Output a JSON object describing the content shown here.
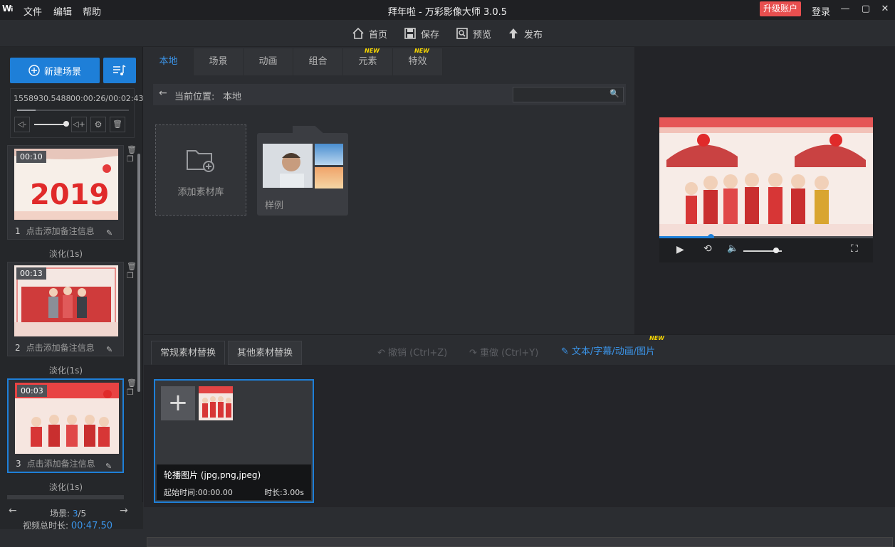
{
  "titlebar": {
    "logo": "W",
    "menu": [
      "文件",
      "编辑",
      "帮助"
    ],
    "title": "拜年啦 - 万彩影像大师 3.0.5",
    "upgrade": "升级账户",
    "login": "登录"
  },
  "toolbar": {
    "home": "首页",
    "save": "保存",
    "preview": "预览",
    "publish": "发布"
  },
  "left": {
    "new_scene": "新建场景",
    "time_left": "1558930.5488",
    "time_right": "00:00:26/00:02:43",
    "scenes": [
      {
        "index": "1",
        "duration": "00:10",
        "note": "点击添加备注信息",
        "transition": "淡化(1s)"
      },
      {
        "index": "2",
        "duration": "00:13",
        "note": "点击添加备注信息",
        "transition": "淡化(1s)"
      },
      {
        "index": "3",
        "duration": "00:03",
        "note": "点击添加备注信息",
        "transition": "淡化(1s)"
      }
    ],
    "footer": {
      "scene_label": "场景:",
      "scene_current": "3",
      "scene_total": "/5",
      "total_label": "视频总时长:",
      "total_value": "00:47.50"
    }
  },
  "center": {
    "tabs": [
      {
        "label": "本地",
        "new": ""
      },
      {
        "label": "场景",
        "new": ""
      },
      {
        "label": "动画",
        "new": ""
      },
      {
        "label": "组合",
        "new": ""
      },
      {
        "label": "元素",
        "new": "NEW"
      },
      {
        "label": "特效",
        "new": "NEW"
      }
    ],
    "path_label": "当前位置:",
    "path_value": "本地",
    "add_library": "添加素材库",
    "folder_name": "样例"
  },
  "bottom": {
    "tab_regular": "常规素材替换",
    "tab_other": "其他素材替换",
    "undo": "撤销 (Ctrl+Z)",
    "redo": "重做 (Ctrl+Y)",
    "text_link": "文本/字幕/动画/图片",
    "text_link_new": "NEW",
    "card": {
      "title": "轮播图片 (jpg,png,jpeg)",
      "start": "起始时间:00:00.00",
      "duration": "时长:3.00s"
    }
  },
  "colors": {
    "accent": "#1e7fd8",
    "upgrade": "#e84f4f",
    "new_tag": "#f6d600"
  },
  "preview": {
    "progress": 0.24,
    "volume": 0.85
  }
}
